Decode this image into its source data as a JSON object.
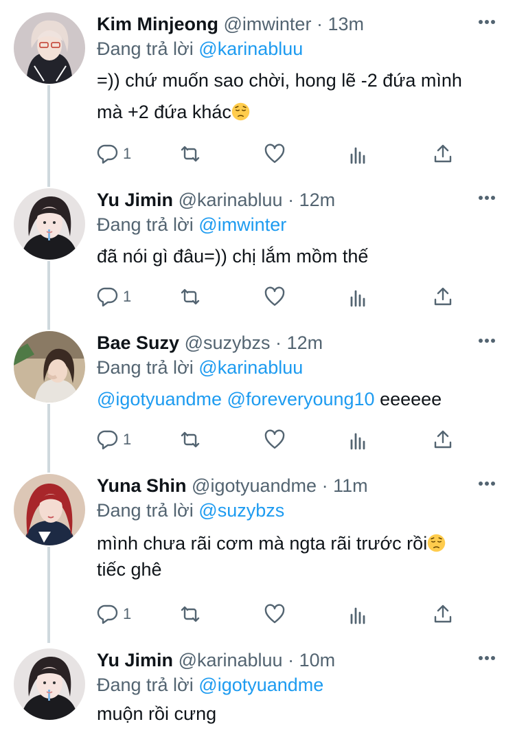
{
  "replying_prefix": "Đang trả lời",
  "colors": {
    "accent": "#1d9bf0",
    "muted": "#536471",
    "text": "#0f1419",
    "thread_line": "#cfd9de"
  },
  "icons": [
    "reply-icon",
    "retweet-icon",
    "like-icon",
    "analytics-icon",
    "share-icon",
    "more-icon",
    "pensive-face-emoji"
  ],
  "tweets": [
    {
      "name": "Kim Minjeong",
      "handle": "@imwinter",
      "sep": "·",
      "time": "13m",
      "replying_to": "@karinabluu",
      "text_line1": "=)) chứ muốn sao chời, hong lẽ -2 đứa mình",
      "text_line2": "mà +2 đứa khác",
      "reply_count": "1"
    },
    {
      "name": "Yu Jimin",
      "handle": "@karinabluu",
      "sep": "·",
      "time": "12m",
      "replying_to": "@imwinter",
      "text": "đã nói gì đâu=)) chị lắm mồm thế",
      "reply_count": "1"
    },
    {
      "name": "Bae Suzy",
      "handle": "@suzybzs",
      "sep": "·",
      "time": "12m",
      "replying_to": "@karinabluu",
      "mention1": "@igotyuandme",
      "mention2": "@foreveryoung10",
      "text_tail": " eeeeee",
      "reply_count": "1"
    },
    {
      "name": "Yuna Shin",
      "handle": "@igotyuandme",
      "sep": "·",
      "time": "11m",
      "replying_to": "@suzybzs",
      "text_line1": "mình chưa rãi cơm mà ngta rãi trước rồi",
      "text_line2": "tiếc ghê",
      "reply_count": "1"
    },
    {
      "name": "Yu Jimin",
      "handle": "@karinabluu",
      "sep": "·",
      "time": "10m",
      "replying_to": "@igotyuandme",
      "text": "muộn rồi cưng"
    }
  ]
}
